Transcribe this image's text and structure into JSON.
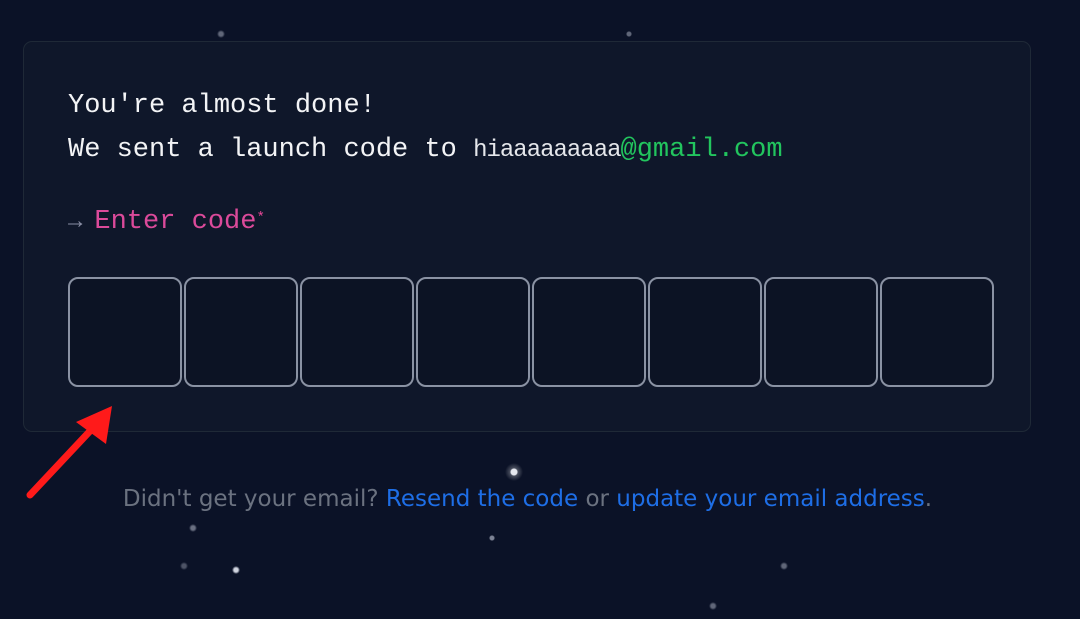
{
  "card": {
    "heading": "You're almost done!",
    "sent_prefix": "We sent a launch code to",
    "email_local": "hiaaaaaaaaa",
    "email_domain": "@gmail.com",
    "enter_arrow": "→",
    "enter_label": "Enter code",
    "required_mark": "*",
    "code_boxes": [
      "",
      "",
      "",
      "",
      "",
      "",
      "",
      ""
    ]
  },
  "footer": {
    "prefix": "Didn't get your email?",
    "resend_link": "Resend the code",
    "or": "or",
    "update_link": "update your email address",
    "suffix": "."
  },
  "colors": {
    "background": "#0b1227",
    "card": "#0f172a",
    "label_pink": "#db4a9a",
    "email_green": "#22c55e",
    "link_blue": "#1e6ee6",
    "annotation_red": "#ff1a1a"
  },
  "icons": {
    "arrow": "right-arrow-icon",
    "annotation": "red-annotation-arrow-icon"
  }
}
